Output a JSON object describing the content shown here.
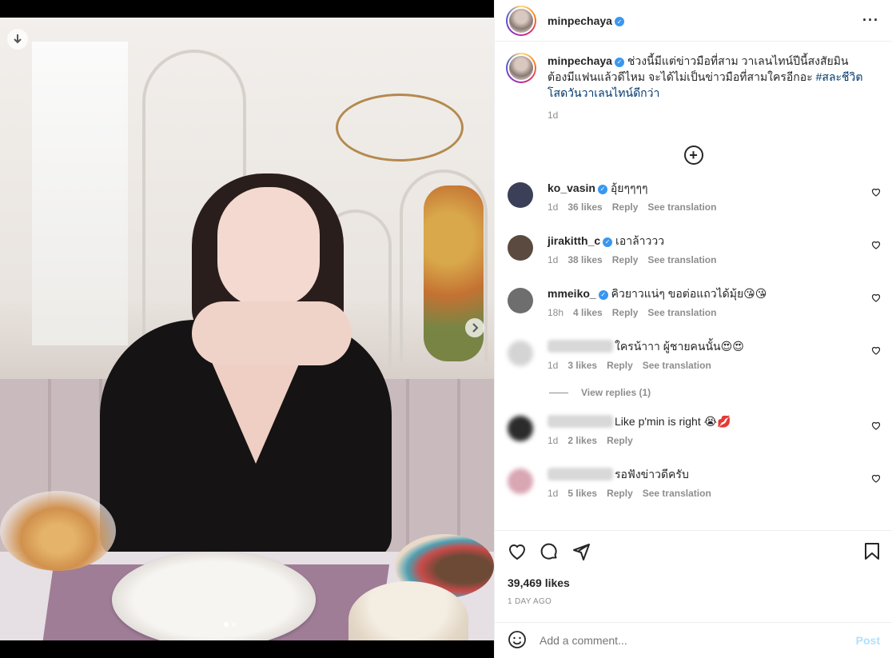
{
  "post": {
    "author": "minpechaya",
    "caption": "ช่วงนี้มีแต่ข่าวมือที่สาม วาเลนไทน์ปีนี้สงสัยมินต้องมีแฟนแล้วดีไหม จะได้ไม่เป็นข่าวมือที่สามใครอีกอะ ",
    "hashtag": "#สละชีวิตโสดวันวาเลนไทน์ดีกว่า",
    "time": "1d",
    "likes": "39,469 likes",
    "date": "1 DAY AGO"
  },
  "comments": [
    {
      "user": "ko_vasin",
      "verified": true,
      "text": "อุ้ยๆๆๆๆ",
      "time": "1d",
      "likes": "36 likes",
      "reply": "Reply",
      "translate": "See translation",
      "avatar_color": "#3b3f57"
    },
    {
      "user": "jirakitth_c",
      "verified": true,
      "text": "เอาล้าววว",
      "time": "1d",
      "likes": "38 likes",
      "reply": "Reply",
      "translate": "See translation",
      "avatar_color": "#5a4a40"
    },
    {
      "user": "mmeiko_",
      "verified": true,
      "text": "คิวยาวแน่ๆ ขอต่อแถวได้มุ้ย😘😘",
      "time": "18h",
      "likes": "4 likes",
      "reply": "Reply",
      "translate": "See translation",
      "avatar_color": "#6e6e6e"
    },
    {
      "user": "",
      "verified": false,
      "text": "ใครน้าาา ผู้ชายคนนั้น😍😍",
      "time": "1d",
      "likes": "3 likes",
      "reply": "Reply",
      "translate": "See translation",
      "avatar_color": "#d4d4d4"
    },
    {
      "user": "",
      "verified": false,
      "text": "Like p'min is right 😭💋",
      "time": "1d",
      "likes": "2 likes",
      "reply": "Reply",
      "translate": "",
      "avatar_color": "#2b2b2b"
    },
    {
      "user": "",
      "verified": false,
      "text": "รอฟังข่าวดีครับ",
      "time": "1d",
      "likes": "5 likes",
      "reply": "Reply",
      "translate": "See translation",
      "avatar_color": "#d9a6b3"
    }
  ],
  "view_replies": "View replies (1)",
  "add_comment": {
    "placeholder": "Add a comment...",
    "post_label": "Post"
  },
  "icons": {
    "download": "download-icon",
    "next": "chevron-right-icon",
    "more": "more-icon",
    "add": "plus-circle-icon",
    "like": "heart-icon",
    "comment": "comment-icon",
    "share": "share-icon",
    "save": "bookmark-icon",
    "emoji": "emoji-icon"
  },
  "colors": {
    "verified": "#3897f0",
    "link": "#00376b",
    "post_button": "#b2dffc"
  }
}
